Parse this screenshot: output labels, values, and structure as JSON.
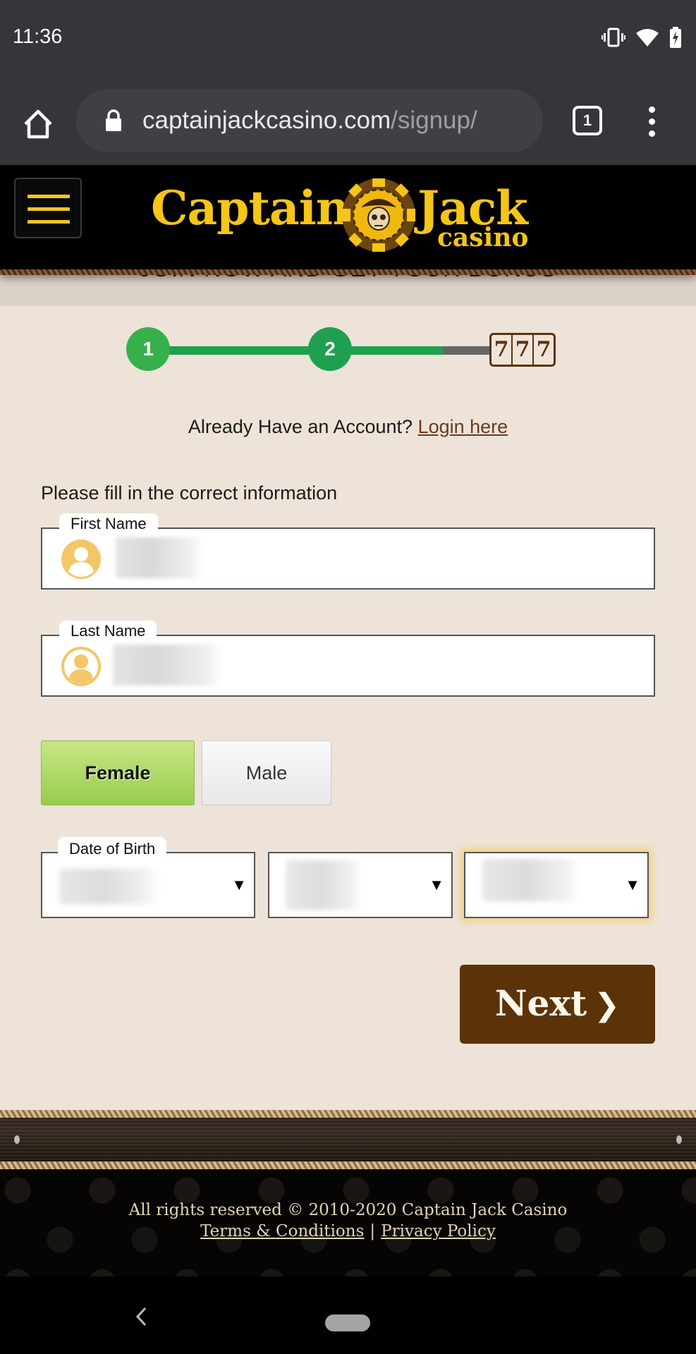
{
  "status_bar": {
    "time": "11:36",
    "icons": [
      "vibrate-icon",
      "wifi-icon",
      "battery-charging-icon"
    ]
  },
  "browser": {
    "url_domain": "captainjackcasino.com",
    "url_path": "/signup/",
    "tab_count": "1",
    "icons": [
      "home-icon",
      "lock-icon",
      "tabs-icon",
      "more-vert-icon"
    ]
  },
  "header": {
    "logo_word_1": "Captain",
    "logo_word_2": "Jack",
    "logo_sub": "casino",
    "menu_icon": "hamburger-icon"
  },
  "promo_banner": {
    "text": "JOIN NOW AND GET YOUR BONUS"
  },
  "progress": {
    "steps": [
      "1",
      "2"
    ],
    "current_step": 2,
    "total_steps": 3,
    "final_step_symbols": [
      "7",
      "7",
      "7"
    ],
    "completion_fraction": 0.82
  },
  "account": {
    "prompt": "Already Have an Account?",
    "login_link": "Login here"
  },
  "form": {
    "instructions": "Please fill in the correct information",
    "first_name": {
      "label": "First Name",
      "value": ""
    },
    "last_name": {
      "label": "Last Name",
      "value": ""
    },
    "gender": {
      "options": [
        "Female",
        "Male"
      ],
      "selected": "Female"
    },
    "dob": {
      "label": "Date of Birth",
      "day": "",
      "month": "",
      "year": "",
      "arrow": "▼"
    },
    "next_label": "Next",
    "next_chevron": "❯"
  },
  "footer": {
    "copyright": "All rights reserved © 2010-2020 Captain Jack Casino",
    "terms_link": "Terms & Conditions",
    "separator": "|",
    "privacy_link": "Privacy Policy"
  },
  "colors": {
    "step_green": "#1fa050",
    "brand_gold": "#f5c518",
    "next_brown": "#5c3209",
    "selected_green": "#98cc4e",
    "page_bg": "#ede3d8"
  }
}
